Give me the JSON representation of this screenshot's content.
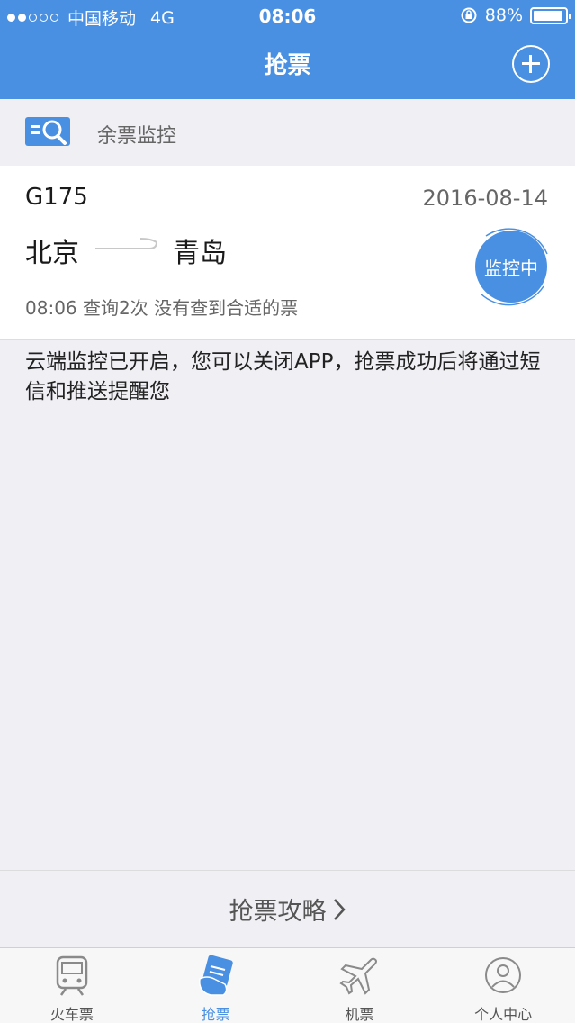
{
  "status": {
    "carrier": "中国移动",
    "network": "4G",
    "time": "08:06",
    "battery": "88%"
  },
  "nav": {
    "title": "抢票"
  },
  "section": {
    "label": "余票监控"
  },
  "ticket": {
    "train_no": "G175",
    "date": "2016-08-14",
    "from": "北京",
    "to": "青岛",
    "query_info": "08:06 查询2次 没有查到合适的票",
    "monitor_label": "监控中"
  },
  "notice": "云端监控已开启，您可以关闭APP，抢票成功后将通过短信和推送提醒您",
  "guide": {
    "label": "抢票攻略"
  },
  "tabs": [
    {
      "label": "火车票",
      "icon": "train-icon"
    },
    {
      "label": "抢票",
      "icon": "ticket-grab-icon"
    },
    {
      "label": "机票",
      "icon": "plane-icon"
    },
    {
      "label": "个人中心",
      "icon": "user-icon"
    }
  ],
  "colors": {
    "accent": "#4a90e2",
    "background": "#efeff4"
  }
}
